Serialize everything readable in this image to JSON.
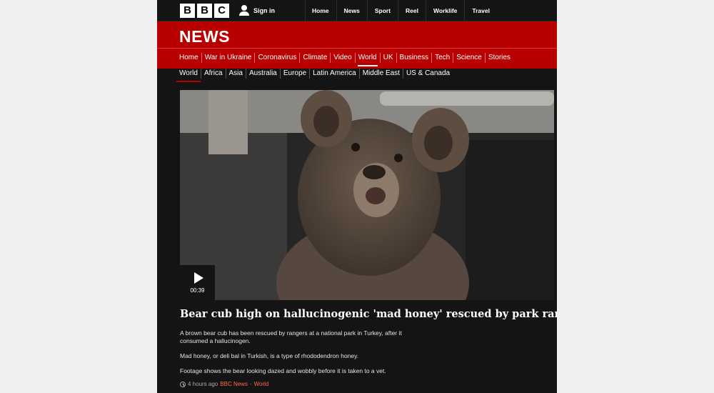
{
  "header": {
    "logo_letters": [
      "B",
      "B",
      "C"
    ],
    "signin_label": "Sign in",
    "nav": [
      "Home",
      "News",
      "Sport",
      "Reel",
      "Worklife",
      "Travel"
    ]
  },
  "news": {
    "logo": "NEWS",
    "nav": [
      "Home",
      "War in Ukraine",
      "Coronavirus",
      "Climate",
      "Video",
      "World",
      "UK",
      "Business",
      "Tech",
      "Science",
      "Stories"
    ],
    "active": "World"
  },
  "subnav": {
    "items": [
      "World",
      "Africa",
      "Asia",
      "Australia",
      "Europe",
      "Latin America",
      "Middle East",
      "US & Canada"
    ],
    "active": "World"
  },
  "video": {
    "duration": "00:39"
  },
  "article": {
    "headline": "Bear cub high on hallucinogenic 'mad honey' rescued by park rangers",
    "paragraphs": [
      "A brown bear cub has been rescued by rangers at a national park in Turkey, after it consumed a hallucinogen.",
      "Mad honey, or deli bal in Turkish, is a type of rhododendron honey.",
      "Footage shows the bear looking dazed and wobbly before it is taken to a vet."
    ],
    "time": "4 hours ago",
    "source": "BBC News",
    "section": "World"
  },
  "colors": {
    "brand_red": "#b80000",
    "background": "#141414",
    "meta_link": "#ff6b4a"
  }
}
